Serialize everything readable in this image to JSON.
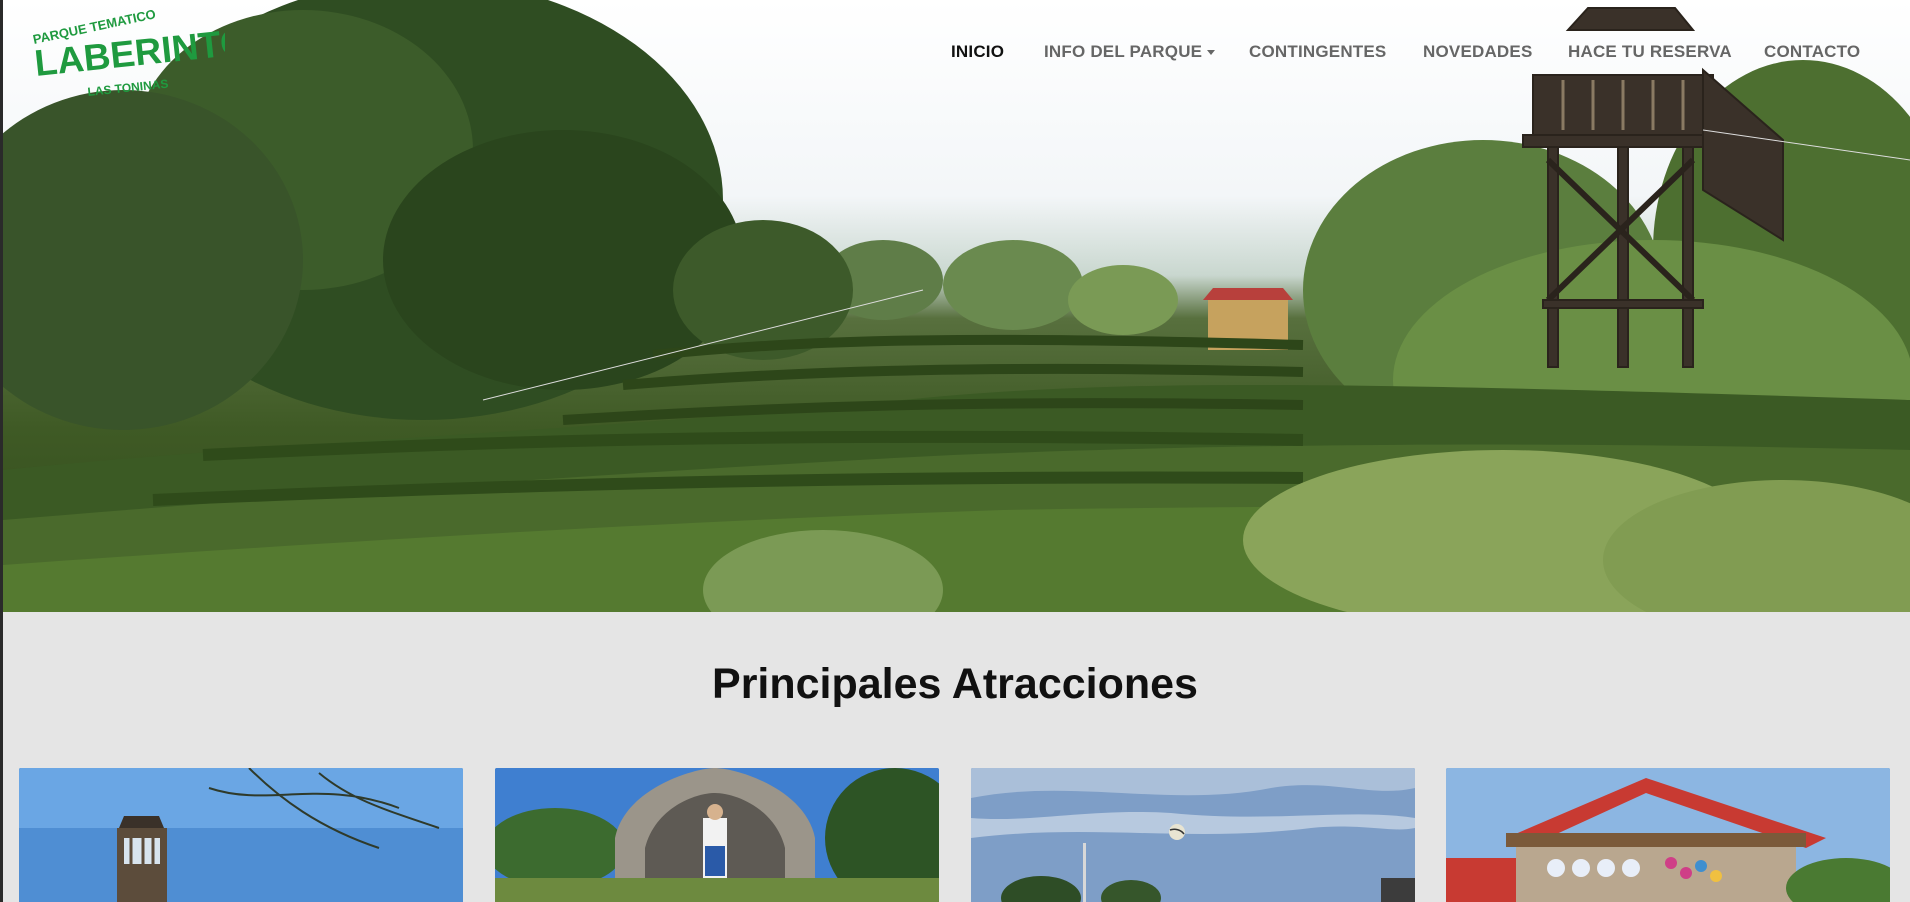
{
  "logo": {
    "line1": "PARQUE TEMATICO",
    "line2": "LABERINTO",
    "line3": "LAS TONINAS",
    "color": "#1f9a3f"
  },
  "nav": {
    "items": [
      {
        "label": "INICIO",
        "active": true
      },
      {
        "label": "INFO DEL PARQUE",
        "dropdown": true
      },
      {
        "label": "CONTINGENTES"
      },
      {
        "label": "NOVEDADES"
      },
      {
        "label": "HACE TU RESERVA"
      },
      {
        "label": "CONTACTO"
      }
    ]
  },
  "hero": {
    "image": "hedge-maze-landscape-with-wooden-tower"
  },
  "attractions": {
    "title": "Principales Atracciones",
    "cards": [
      {
        "image": "wooden-tower-photo"
      },
      {
        "image": "stone-grotto-statue-photo"
      },
      {
        "image": "sky-with-ball-photo"
      },
      {
        "image": "souvenir-stall-photo"
      }
    ]
  }
}
